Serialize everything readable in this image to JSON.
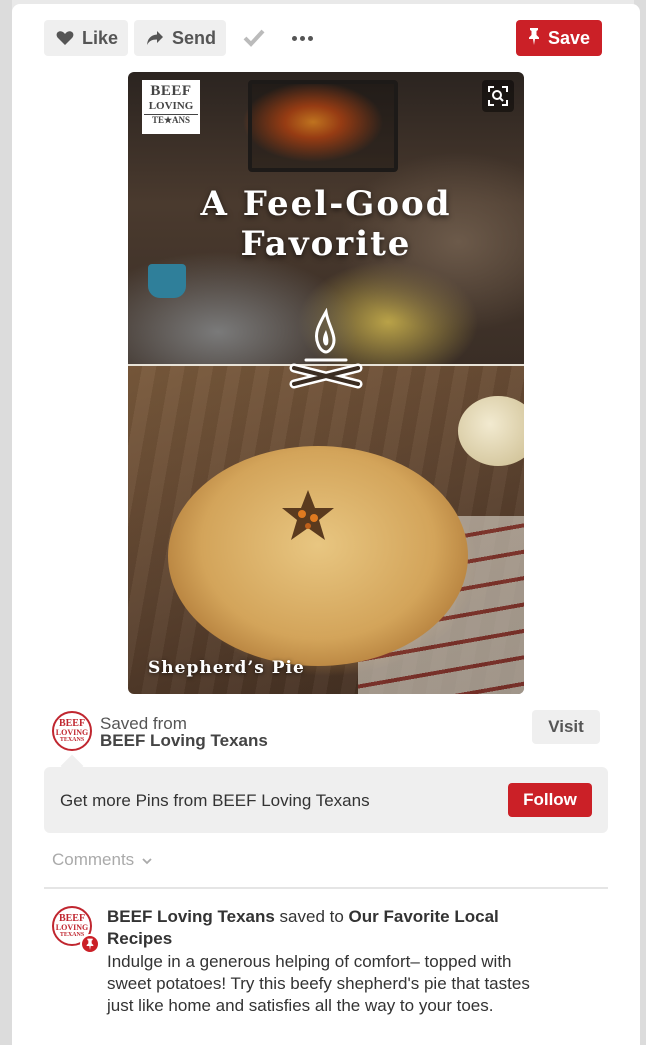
{
  "toolbar": {
    "like_label": "Like",
    "send_label": "Send",
    "save_label": "Save"
  },
  "pin": {
    "logo_line1": "BEEF",
    "logo_line2": "LOVING",
    "logo_line3": "TE★ANS",
    "headline_line1": "A Feel-Good",
    "headline_line2": "Favorite",
    "caption": "Shepherd’s Pie"
  },
  "source": {
    "saved_from_label": "Saved from",
    "name": "BEEF Loving Texans",
    "visit_label": "Visit"
  },
  "follow": {
    "text": "Get more Pins from BEEF Loving Texans",
    "button_label": "Follow"
  },
  "comments": {
    "label": "Comments"
  },
  "activity": {
    "user": "BEEF Loving Texans",
    "action": " saved to ",
    "board": "Our Favorite Local Recipes",
    "description": "Indulge in a generous helping of comfort– topped with sweet potatoes! Try this beefy shepherd's pie that tastes just like home and satisfies all the way to your toes."
  },
  "avatar": {
    "line1": "BEEF",
    "line2": "LOVING",
    "line3": "TEXANS"
  },
  "colors": {
    "accent": "#cb2027",
    "button_bg": "#efefef"
  },
  "icons": [
    "heart-icon",
    "send-arrow-icon",
    "check-icon",
    "more-dots-icon",
    "pin-icon",
    "zoom-icon",
    "campfire-icon",
    "chevron-down-icon"
  ]
}
